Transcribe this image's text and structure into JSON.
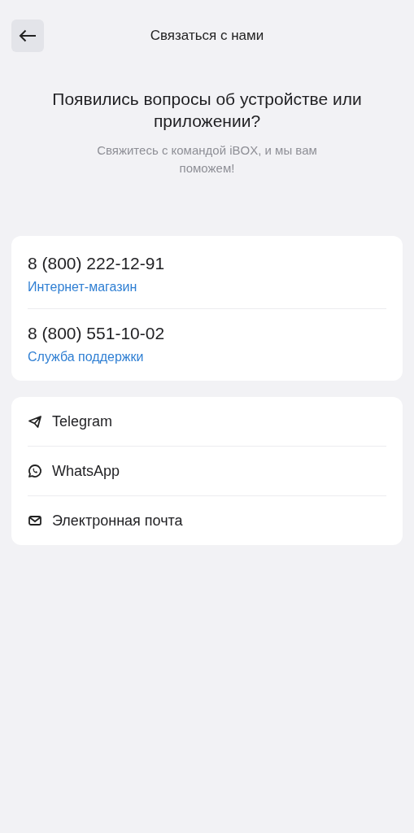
{
  "header": {
    "title": "Связаться с нами"
  },
  "intro": {
    "heading": "Появились вопросы об устройстве или приложении?",
    "subtitle": "Свяжитесь с командой iBOX, и мы вам поможем!"
  },
  "phones": [
    {
      "number": "8 (800) 222-12-91",
      "label": "Интернет-магазин"
    },
    {
      "number": "8 (800) 551-10-02",
      "label": "Служба поддержки"
    }
  ],
  "channels": [
    {
      "kind": "telegram",
      "label": "Telegram"
    },
    {
      "kind": "whatsapp",
      "label": "WhatsApp"
    },
    {
      "kind": "email",
      "label": "Электронная почта"
    }
  ]
}
